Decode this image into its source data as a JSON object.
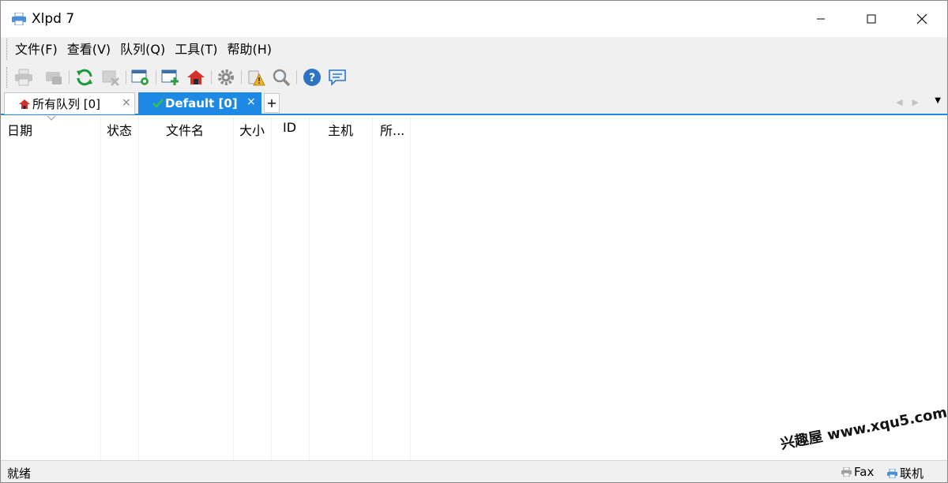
{
  "window": {
    "title": "Xlpd 7"
  },
  "menu": {
    "items": [
      "文件(F)",
      "查看(V)",
      "队列(Q)",
      "工具(T)",
      "帮助(H)"
    ]
  },
  "toolbar": {
    "icons": [
      "printer-icon",
      "print-disabled-icon",
      "refresh-icon",
      "delete-icon",
      "queue-settings-icon",
      "add-queue-icon",
      "home-icon",
      "gear-icon",
      "alert-icon",
      "search-icon",
      "help-icon",
      "chat-icon"
    ]
  },
  "tabs": [
    {
      "label": "所有队列 [0]",
      "close": "×"
    },
    {
      "label": "Default [0]",
      "close": "×"
    }
  ],
  "tab_add": "+",
  "table": {
    "columns": [
      "日期",
      "状态",
      "文件名",
      "大小",
      "ID",
      "主机",
      "所..."
    ]
  },
  "status": {
    "text": "就绪",
    "fax_label": "Fax",
    "online_label": "联机"
  },
  "watermark": "兴趣屋 www.xqu5.com",
  "colors": {
    "accent": "#1e88e5",
    "chrome": "#f0f0f0"
  }
}
